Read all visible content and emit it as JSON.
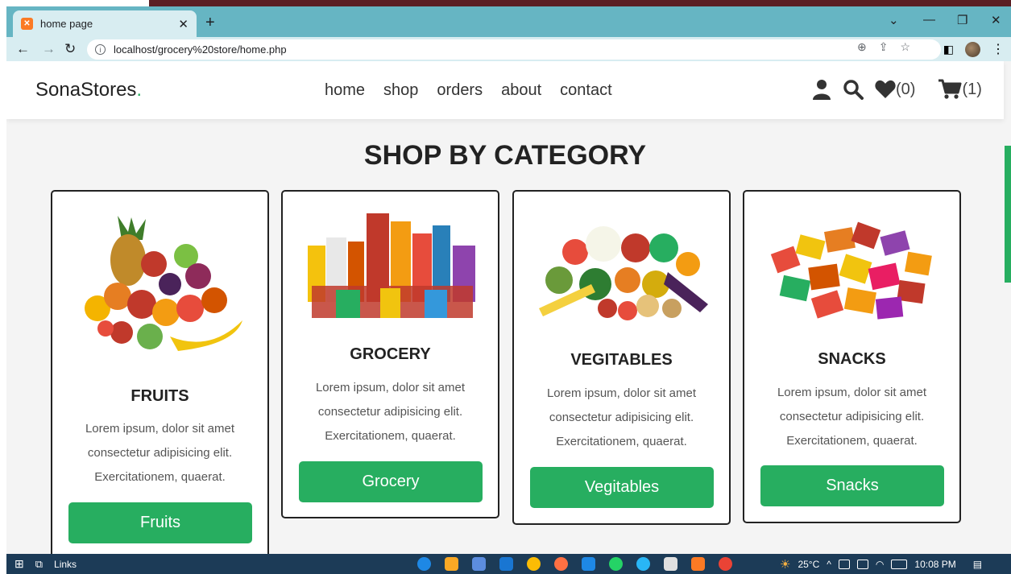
{
  "browser": {
    "tab_title": "home page",
    "new_tab": "+",
    "url": "localhost/grocery%20store/home.php",
    "window_controls": [
      "chevron-down-icon",
      "minimize-icon",
      "restore-icon",
      "close-icon"
    ]
  },
  "header": {
    "logo": "SonaStores",
    "logo_dot": ".",
    "nav": [
      "home",
      "shop",
      "orders",
      "about",
      "contact"
    ],
    "wishlist_count": "(0)",
    "cart_count": "(1)",
    "icons": [
      "user-icon",
      "search-icon",
      "heart-icon",
      "cart-icon"
    ]
  },
  "main": {
    "heading": "SHOP BY CATEGORY",
    "cards": [
      {
        "title": "FRUITS",
        "text": "Lorem ipsum, dolor sit amet consectetur adipisicing elit. Exercitationem, quaerat.",
        "button": "Fruits"
      },
      {
        "title": "GROCERY",
        "text": "Lorem ipsum, dolor sit amet consectetur adipisicing elit. Exercitationem, quaerat.",
        "button": "Grocery"
      },
      {
        "title": "VEGITABLES",
        "text": "Lorem ipsum, dolor sit amet consectetur adipisicing elit. Exercitationem, quaerat.",
        "button": "Vegitables"
      },
      {
        "title": "SNACKS",
        "text": "Lorem ipsum, dolor sit amet consectetur adipisicing elit. Exercitationem, quaerat.",
        "button": "Snacks"
      }
    ]
  },
  "taskbar": {
    "links_label": "Links",
    "temperature": "25°C",
    "time": "10:08 PM"
  },
  "colors": {
    "accent": "#27ae60",
    "tabbar": "#66b5c3",
    "taskbar": "#1c3b57"
  }
}
